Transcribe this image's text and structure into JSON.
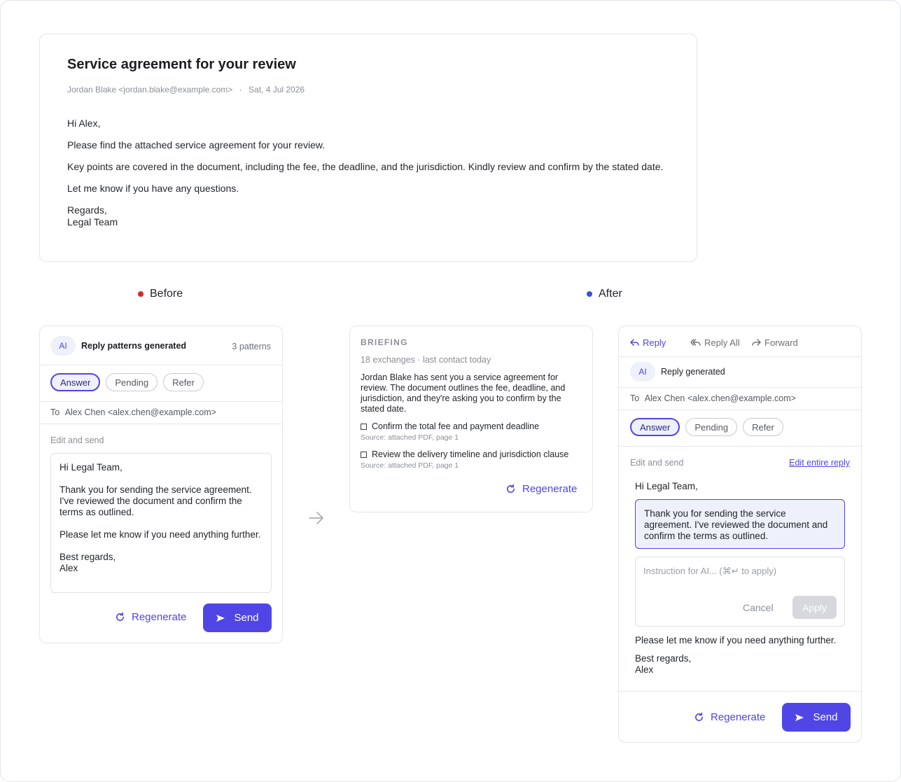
{
  "email": {
    "subject": "Service agreement for your review",
    "sender": "Jordan Blake <jordan.blake@example.com>",
    "separator": "·",
    "date": "Sat, 4 Jul 2026",
    "greeting": "Hi Alex,",
    "para1": "Please find the attached service agreement for your review.",
    "para2": "Key points are covered in the document, including the fee, the deadline, and the jurisdiction. Kindly review and confirm by the stated date.",
    "para3": "Let me know if you have any questions.",
    "signoff": "Regards,",
    "signature": "Legal Team"
  },
  "legends": {
    "before": "Before",
    "after": "After",
    "before_color": "#d42a2a",
    "after_color": "#2f56d9"
  },
  "before": {
    "ai_badge": "AI",
    "title": "Reply patterns generated",
    "count": "3 patterns",
    "chips": [
      "Answer",
      "Pending",
      "Refer"
    ],
    "to_label": "To",
    "to_value": "Alex Chen <alex.chen@example.com>",
    "edit_label": "Edit and send",
    "draft": "Hi Legal Team,\n\nThank you for sending the service agreement. I've reviewed the document and confirm the terms as outlined.\n\nPlease let me know if you need anything further.\n\nBest regards,\nAlex",
    "regenerate": "Regenerate",
    "send": "Send"
  },
  "briefing": {
    "heading": "BRIEFING",
    "meta": "18 exchanges · last contact today",
    "summary": "Jordan Blake has sent you a service agreement for review. The document outlines the fee, deadline, and jurisdiction, and they're asking you to confirm by the stated date.",
    "items": [
      {
        "text": "Confirm the total fee and payment deadline",
        "source": "Source: attached PDF, page 1"
      },
      {
        "text": "Review the delivery timeline and jurisdiction clause",
        "source": "Source: attached PDF, page 1"
      }
    ],
    "regenerate": "Regenerate"
  },
  "after": {
    "tabs": {
      "reply": "Reply",
      "reply_all": "Reply All",
      "forward": "Forward"
    },
    "ai_badge": "AI",
    "title": "Reply generated",
    "to_label": "To",
    "to_value": "Alex Chen <alex.chen@example.com>",
    "chips": [
      "Answer",
      "Pending",
      "Refer"
    ],
    "edit_label": "Edit and send",
    "edit_entire": "Edit entire reply",
    "greeting": "Hi Legal Team,",
    "highlight": "Thank you for sending the service agreement. I've reviewed the document and confirm the terms as outlined.",
    "instruction_placeholder": "Instruction for AI... (⌘↵ to apply)",
    "cancel": "Cancel",
    "apply": "Apply",
    "closing_line": "Please let me know if you need anything further.",
    "signoff": "Best regards,",
    "signature": "Alex",
    "regenerate": "Regenerate",
    "send": "Send"
  },
  "colors": {
    "accent": "#4f46e5",
    "accent_bg": "#eef0fb"
  }
}
